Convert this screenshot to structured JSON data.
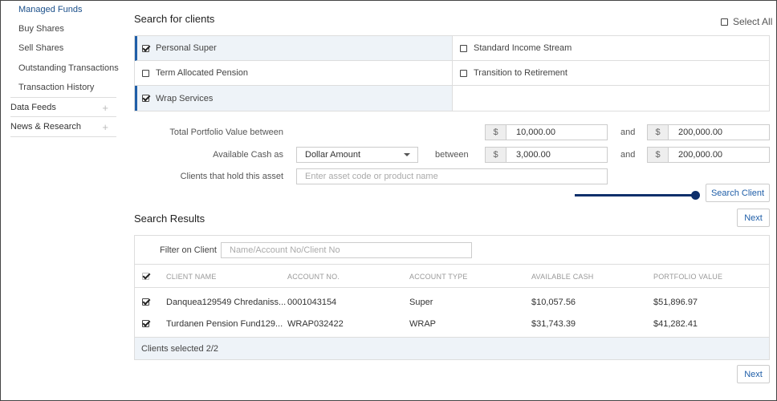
{
  "sidebar": {
    "sub_items": [
      "Managed Funds",
      "Buy Shares",
      "Sell Shares",
      "Outstanding Transactions",
      "Transaction History"
    ],
    "sections": [
      "Data Feeds",
      "News & Research"
    ],
    "plus": "+"
  },
  "search": {
    "title": "Search for clients",
    "select_all": "Select All",
    "types": [
      {
        "label": "Personal Super",
        "checked": true
      },
      {
        "label": "Standard Income Stream",
        "checked": false
      },
      {
        "label": "Term Allocated Pension",
        "checked": false
      },
      {
        "label": "Transition to Retirement",
        "checked": false
      },
      {
        "label": "Wrap Services",
        "checked": true
      }
    ],
    "portfolio_label": "Total Portfolio Value between",
    "cash_label": "Available Cash as",
    "asset_label": "Clients that hold this asset",
    "currency": "$",
    "and": "and",
    "between": "between",
    "portfolio_min": "10,000.00",
    "portfolio_max": "200,000.00",
    "cash_type": "Dollar Amount",
    "cash_min": "3,000.00",
    "cash_max": "200,000.00",
    "asset_placeholder": "Enter asset code or product name",
    "search_button": "Search Client"
  },
  "results": {
    "title": "Search Results",
    "next": "Next",
    "filter_label": "Filter on Client",
    "filter_placeholder": "Name/Account No/Client No",
    "columns": [
      "CLIENT NAME",
      "ACCOUNT NO.",
      "ACCOUNT TYPE",
      "AVAILABLE CASH",
      "PORTFOLIO VALUE"
    ],
    "rows": [
      {
        "name": "Danquea129549 Chredaniss...",
        "account": "0001043154",
        "type": "Super",
        "cash": "$10,057.56",
        "value": "$51,896.97"
      },
      {
        "name": "Turdanen Pension Fund129...",
        "account": "WRAP032422",
        "type": "WRAP",
        "cash": "$31,743.39",
        "value": "$41,282.41"
      }
    ],
    "selected": "Clients selected 2/2"
  },
  "colors": {
    "accent": "#1f5ea8",
    "indicator": "#0d2f6b",
    "highlight": "#eef3f8"
  }
}
